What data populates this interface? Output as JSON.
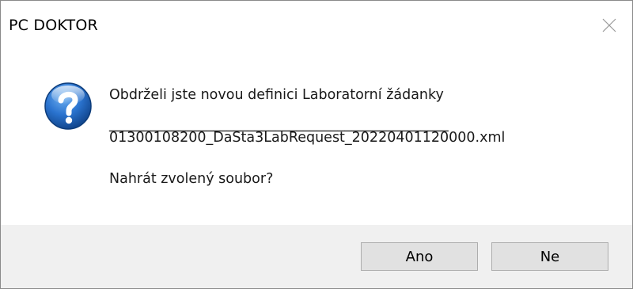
{
  "window": {
    "title": "PC DOKTOR"
  },
  "message": {
    "line1": "Obdrželi jste novou definici Laboratorní žádanky",
    "separator": "_________________________________________________",
    "filename": "01300108200_DaSta3LabRequest_20220401120000.xml",
    "question": "Nahrát zvolený soubor?"
  },
  "buttons": {
    "yes_label": "Ano",
    "no_label": "Ne"
  },
  "icons": {
    "main": "question-icon",
    "close": "close-icon"
  },
  "colors": {
    "footer_bg": "#f0f0f0",
    "button_bg": "#e1e1e1",
    "icon_blue": "#1c5fb5"
  }
}
